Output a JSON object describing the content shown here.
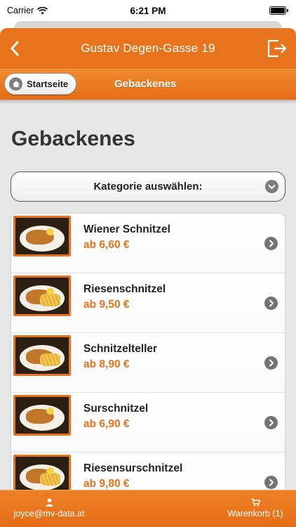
{
  "status": {
    "carrier": "Carrier",
    "time": "6:21 PM"
  },
  "header": {
    "title": "Gustav Degen-Gasse 19"
  },
  "breadcrumb": {
    "home_label": "Startseite",
    "current": "Gebackenes"
  },
  "page": {
    "title": "Gebackenes"
  },
  "category": {
    "label": "Kategorie auswählen:"
  },
  "items": [
    {
      "name": "Wiener Schnitzel",
      "price": "ab 6,60 €"
    },
    {
      "name": "Riesenschnitzel",
      "price": "ab 9,50 €"
    },
    {
      "name": "Schnitzelteller",
      "price": "ab 8,90 €"
    },
    {
      "name": "Surschnitzel",
      "price": "ab 6,90 €"
    },
    {
      "name": "Riesensurschnitzel",
      "price": "ab 9,80 €"
    }
  ],
  "footer": {
    "user": "joyce@mv-data.at",
    "cart": "Warenkorb (1)"
  },
  "colors": {
    "accent": "#e8731d",
    "price": "#e8731d"
  }
}
